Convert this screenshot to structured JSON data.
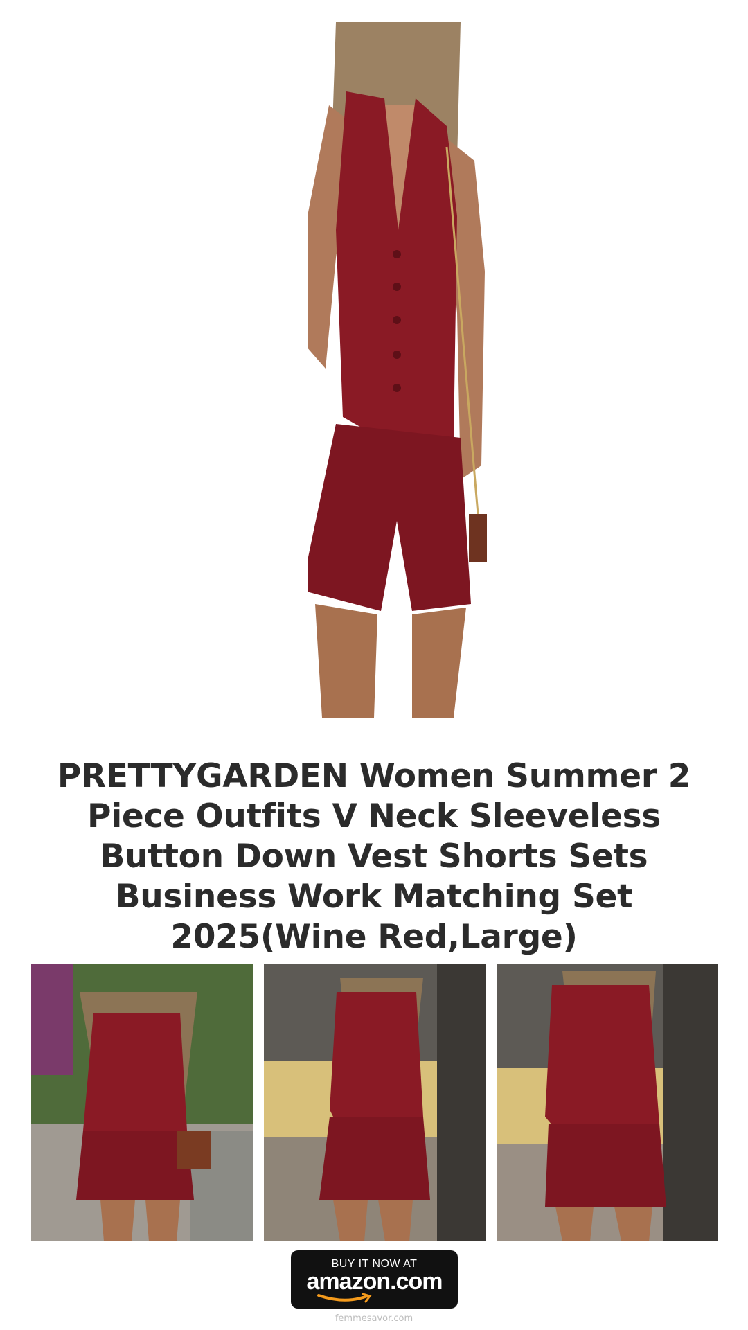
{
  "product": {
    "title": "PRETTYGARDEN Women Summer 2 Piece Outfits V Neck Sleeveless Button Down Vest Shorts Sets Business Work Matching Set 2025(Wine Red,Large)"
  },
  "cta": {
    "line1": "BUY IT NOW AT",
    "logo_text": "amazon.com"
  },
  "footer": {
    "site": "femmesavor.com"
  },
  "colors": {
    "outfit": "#8a1a25",
    "title_text": "#2b2b2b",
    "button_bg": "#111111",
    "amazon_smile": "#f59b1c"
  },
  "images": {
    "hero": "model-wine-red-vest-shorts",
    "thumbnails": [
      "outdoor-garden-front-view",
      "street-front-view",
      "street-angled-view"
    ]
  }
}
